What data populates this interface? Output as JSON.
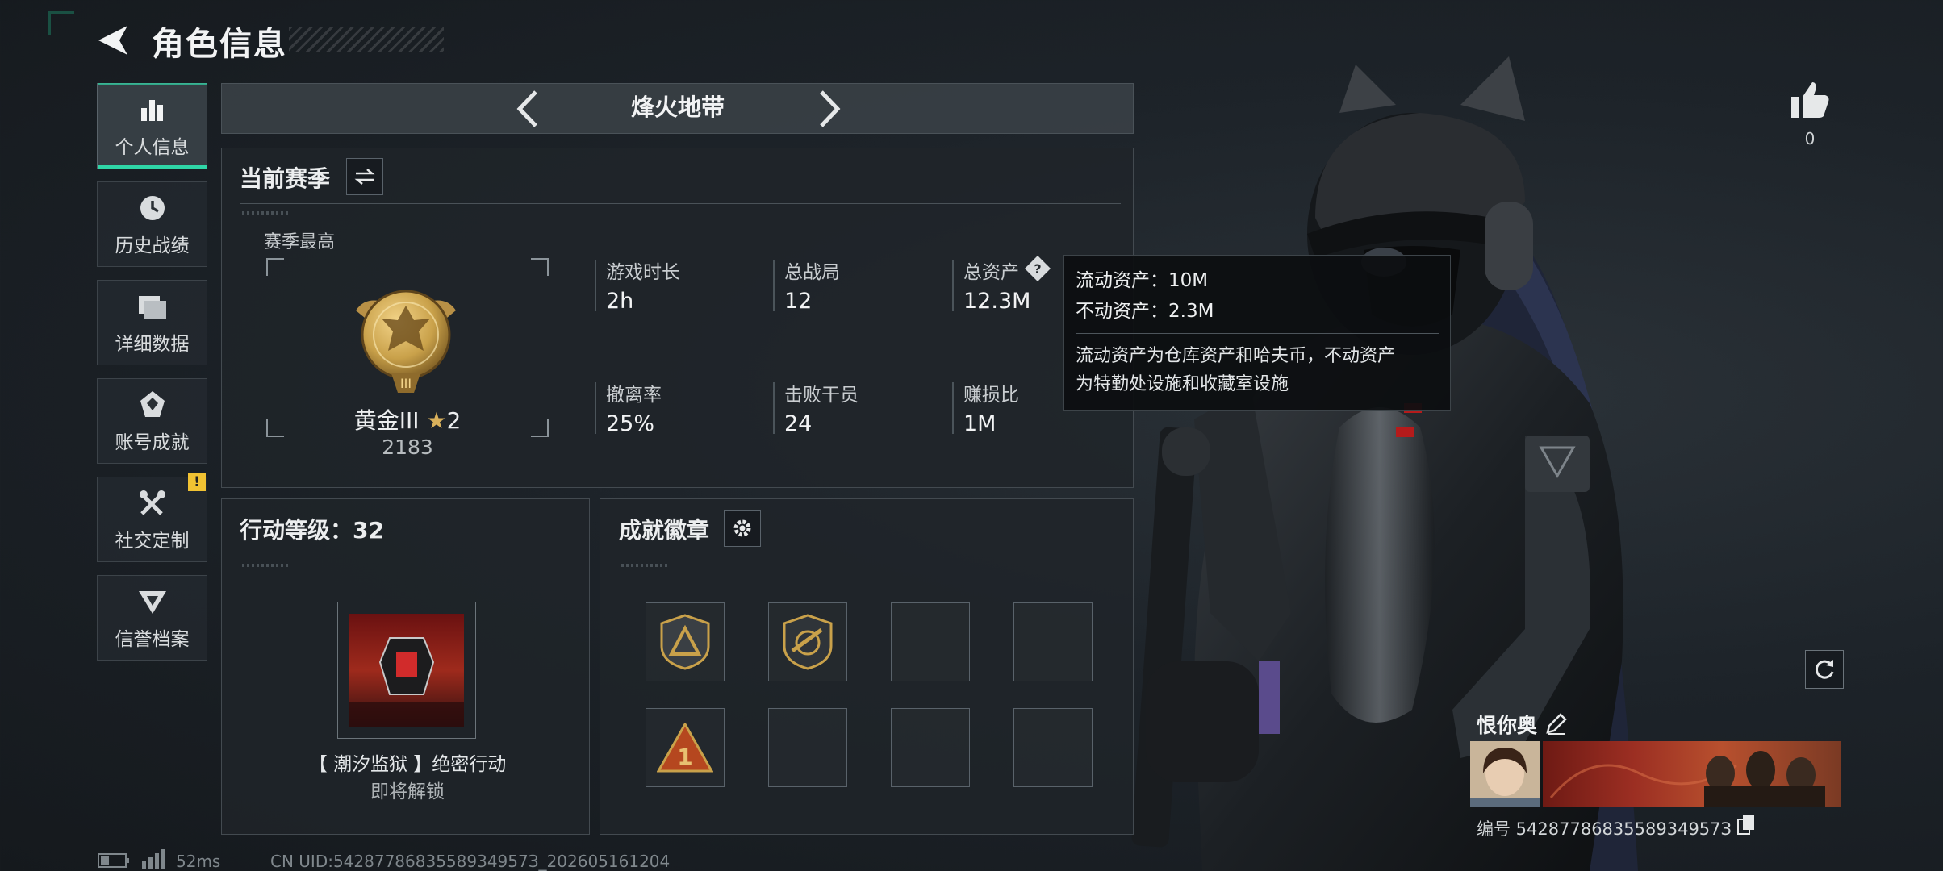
{
  "header": {
    "title": "角色信息"
  },
  "sidebar": {
    "items": [
      {
        "label": "个人信息",
        "active": true
      },
      {
        "label": "历史战绩"
      },
      {
        "label": "详细数据"
      },
      {
        "label": "账号成就"
      },
      {
        "label": "社交定制",
        "alert": "!"
      },
      {
        "label": "信誉档案"
      }
    ]
  },
  "mode": {
    "title": "烽火地带"
  },
  "season": {
    "title": "当前赛季",
    "best_label": "赛季最高",
    "rank": {
      "name": "黄金III",
      "stars": "2",
      "score": "2183"
    },
    "stats": [
      {
        "label": "游戏时长",
        "value": "2h"
      },
      {
        "label": "总战局",
        "value": "12"
      },
      {
        "label": "总资产",
        "value": "12.3M"
      },
      {
        "label": "撤离率",
        "value": "25%"
      },
      {
        "label": "击败干员",
        "value": "24"
      },
      {
        "label": "赚损比",
        "value": "1M"
      }
    ]
  },
  "tooltip": {
    "liquid": "流动资产：10M",
    "fixed": "不动资产：2.3M",
    "desc_line1": "流动资产为仓库资产和哈夫币，不动资产",
    "desc_line2": "为特勤处设施和收藏室设施"
  },
  "level": {
    "title": "行动等级：32",
    "operation_name": "【 潮汐监狱 】绝密行动",
    "operation_status": "即将解锁"
  },
  "badges": {
    "title": "成就徽章",
    "slots": [
      "delta-shield-badge",
      "rifle-shield-badge",
      "empty",
      "empty",
      "rank-one-badge",
      "empty",
      "empty",
      "empty"
    ]
  },
  "social": {
    "likes": "0"
  },
  "player": {
    "name": "恨你奥",
    "id": "编号 5428778683558934957З"
  },
  "footer": {
    "ping": "52ms",
    "uid": "CN UID:5428778683558934957З_202605161204"
  },
  "colors": {
    "accent": "#2fd6a7",
    "alert": "#f1c232",
    "gold": "#c9a14a"
  }
}
